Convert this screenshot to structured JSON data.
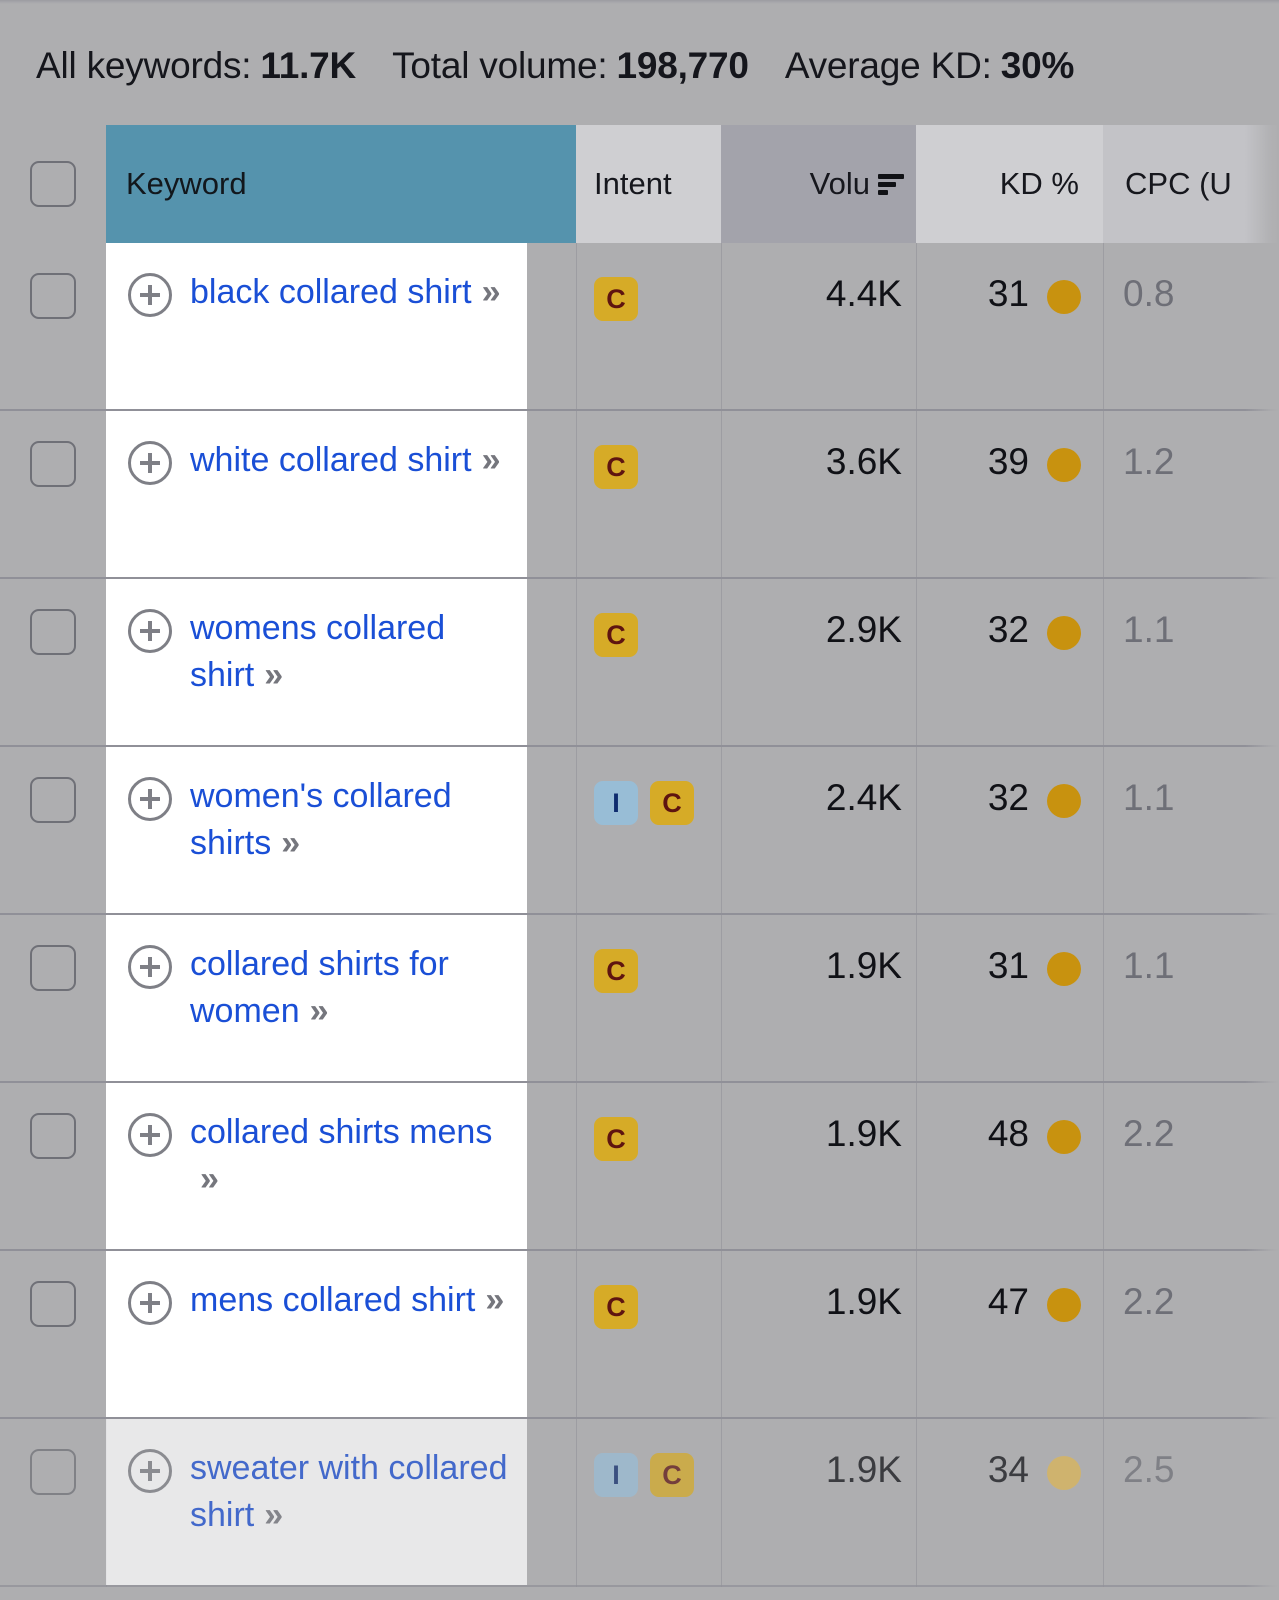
{
  "summary": {
    "items": [
      {
        "label": "All keywords:",
        "value": "11.7K"
      },
      {
        "label": "Total volume:",
        "value": "198,770"
      },
      {
        "label": "Average KD:",
        "value": "30%"
      }
    ]
  },
  "table": {
    "columns": {
      "keyword": "Keyword",
      "intent": "Intent",
      "volume": "Volu",
      "kd": "KD %",
      "cpc": "CPC (U"
    },
    "sort": {
      "column": "volume",
      "icon": "sort-descending-icon"
    },
    "active_column": "keyword",
    "colors": {
      "header_active": "#5593ad",
      "link": "#1a4fd6",
      "badge_commercial_bg": "#d6ab27",
      "badge_commercial_fg": "#5e1410",
      "badge_informational_bg": "#98bdd6",
      "badge_informational_fg": "#0f2c6e",
      "kd_dot_default": "#c8920f",
      "kd_dot_light": "#ddb656",
      "page_bg": "#aeaeb0"
    },
    "rows": [
      {
        "keyword": "black collared shirt",
        "intent": [
          {
            "code": "C",
            "type": "commercial"
          }
        ],
        "volume": "4.4K",
        "kd": "31",
        "kd_dot": "#c8920f",
        "cpc": "0.8",
        "faded": false
      },
      {
        "keyword": "white collared shirt",
        "intent": [
          {
            "code": "C",
            "type": "commercial"
          }
        ],
        "volume": "3.6K",
        "kd": "39",
        "kd_dot": "#c8920f",
        "cpc": "1.2",
        "faded": false
      },
      {
        "keyword": "womens collared shirt",
        "intent": [
          {
            "code": "C",
            "type": "commercial"
          }
        ],
        "volume": "2.9K",
        "kd": "32",
        "kd_dot": "#c8920f",
        "cpc": "1.1",
        "faded": false
      },
      {
        "keyword": "women's collared shirts",
        "intent": [
          {
            "code": "I",
            "type": "informational"
          },
          {
            "code": "C",
            "type": "commercial"
          }
        ],
        "volume": "2.4K",
        "kd": "32",
        "kd_dot": "#c8920f",
        "cpc": "1.1",
        "faded": false
      },
      {
        "keyword": "collared shirts for women",
        "intent": [
          {
            "code": "C",
            "type": "commercial"
          }
        ],
        "volume": "1.9K",
        "kd": "31",
        "kd_dot": "#c8920f",
        "cpc": "1.1",
        "faded": false
      },
      {
        "keyword": "collared shirts mens",
        "intent": [
          {
            "code": "C",
            "type": "commercial"
          }
        ],
        "volume": "1.9K",
        "kd": "48",
        "kd_dot": "#c8920f",
        "cpc": "2.2",
        "faded": false
      },
      {
        "keyword": "mens collared shirt",
        "intent": [
          {
            "code": "C",
            "type": "commercial"
          }
        ],
        "volume": "1.9K",
        "kd": "47",
        "kd_dot": "#c8920f",
        "cpc": "2.2",
        "faded": false
      },
      {
        "keyword": "sweater with collared shirt",
        "intent": [
          {
            "code": "I",
            "type": "informational"
          },
          {
            "code": "C",
            "type": "commercial"
          }
        ],
        "volume": "1.9K",
        "kd": "34",
        "kd_dot": "#ddb656",
        "cpc": "2.5",
        "faded": true
      }
    ],
    "expand_icon": "plus-circle-icon",
    "keyword_suffix_icon": "chevron-double-right-icon"
  }
}
